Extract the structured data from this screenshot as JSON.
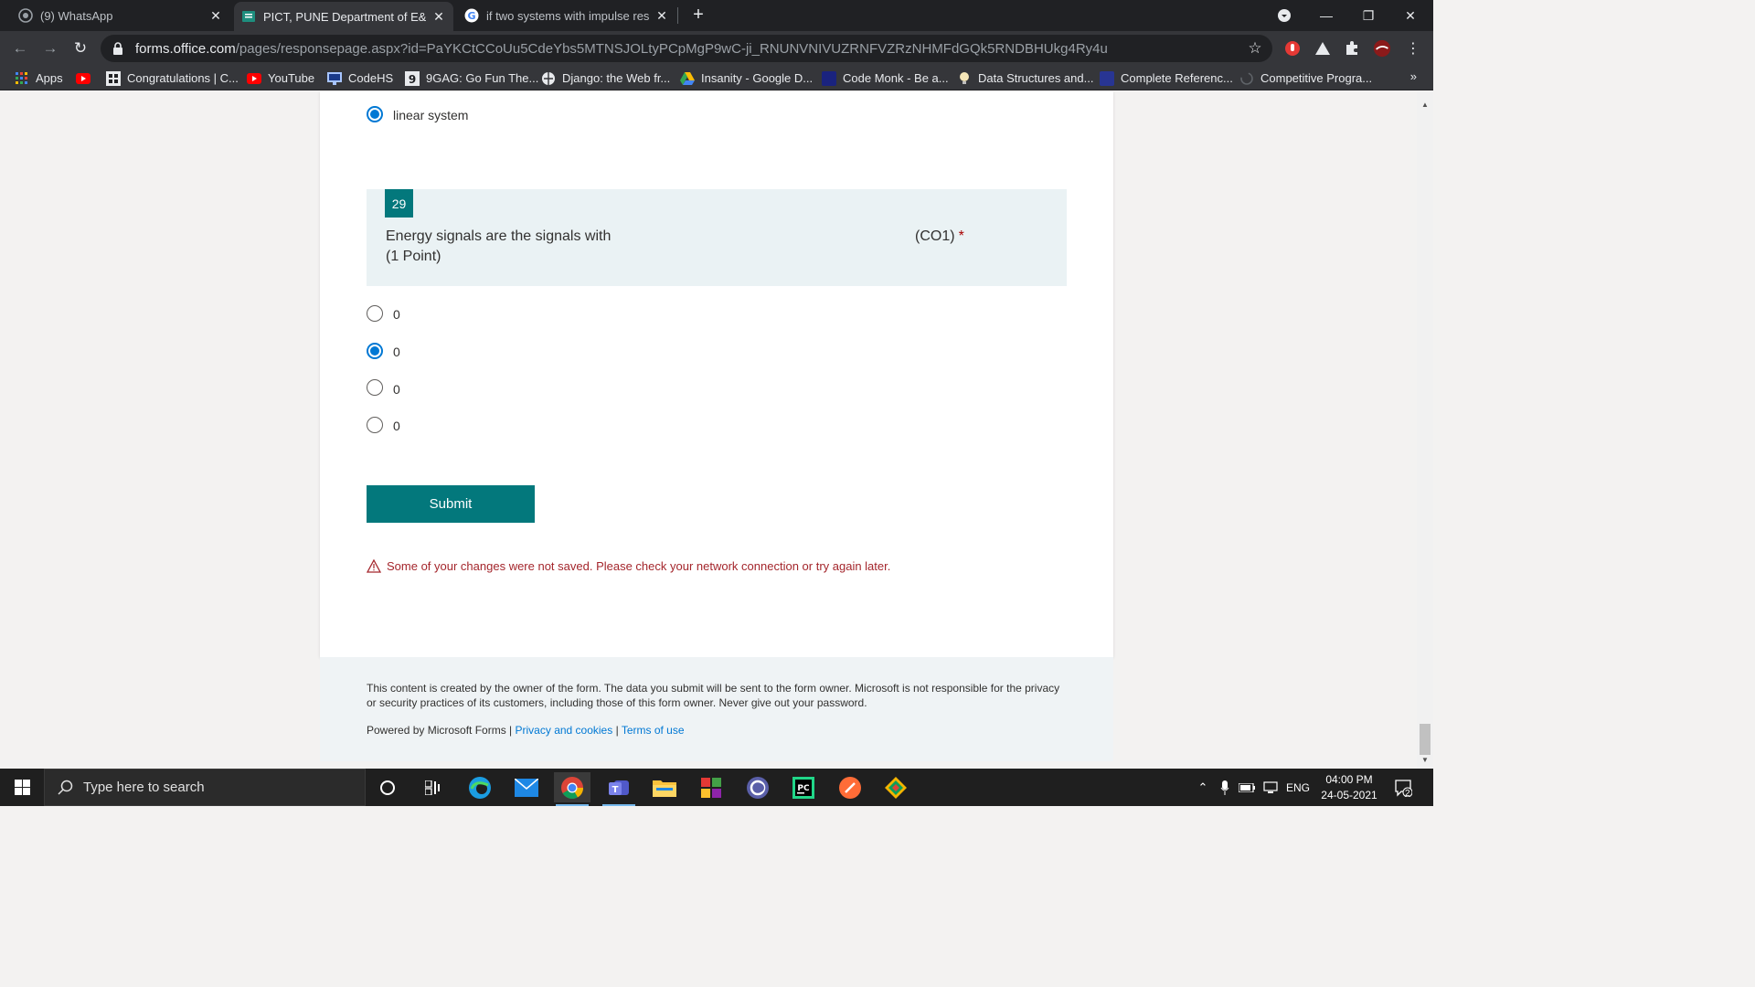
{
  "browser": {
    "tabs": [
      {
        "title": "(9) WhatsApp"
      },
      {
        "title": "PICT, PUNE Department of E&TC"
      },
      {
        "title": "if two systems with impulse response"
      }
    ],
    "url_host": "forms.office.com",
    "url_path": "/pages/responsepage.aspx?id=PaYKCtCCoUu5CdeYbs5MTNSJOLtyPCpMgP9wC-ji_RNUNVNIVUZRNFVZRzNHMFdGQk5RNDBHUkg4Ry4u"
  },
  "bookmarks": [
    {
      "label": "Apps"
    },
    {
      "label": "Congratulations | C..."
    },
    {
      "label": "YouTube"
    },
    {
      "label": "CodeHS"
    },
    {
      "label": "9GAG: Go Fun The..."
    },
    {
      "label": "Django: the Web fr..."
    },
    {
      "label": "Insanity - Google D..."
    },
    {
      "label": "Code Monk - Be a..."
    },
    {
      "label": "Data Structures and..."
    },
    {
      "label": "Complete Referenc..."
    },
    {
      "label": "Competitive Progra..."
    }
  ],
  "bookmarks_more": "»",
  "form": {
    "prev_option": {
      "label": "linear system",
      "selected": true
    },
    "question": {
      "number": "29",
      "text": "Energy signals are the signals with",
      "points": "(1 Point)",
      "course_outcome": "(CO1)",
      "required_mark": "*"
    },
    "options": [
      {
        "label": "0",
        "selected": false
      },
      {
        "label": "0",
        "selected": true
      },
      {
        "label": "0",
        "selected": false
      },
      {
        "label": "0",
        "selected": false
      }
    ],
    "submit_label": "Submit",
    "error_message": "Some of your changes were not saved. Please check your network connection or try again later."
  },
  "footer": {
    "disclaimer": "This content is created by the owner of the form. The data you submit will be sent to the form owner. Microsoft is not responsible for the privacy or security practices of its customers, including those of this form owner. Never give out your password.",
    "powered_by": "Powered by Microsoft Forms |",
    "privacy_link": "Privacy and cookies",
    "separator": "|",
    "terms_link": "Terms of use"
  },
  "taskbar": {
    "search_placeholder": "Type here to search",
    "language": "ENG",
    "time": "04:00 PM",
    "date": "24-05-2021",
    "notification_count": "2"
  },
  "colors": {
    "accent": "#03787c",
    "link": "#0078d4",
    "error": "#a4262c",
    "question_bg": "#eaf2f4"
  }
}
